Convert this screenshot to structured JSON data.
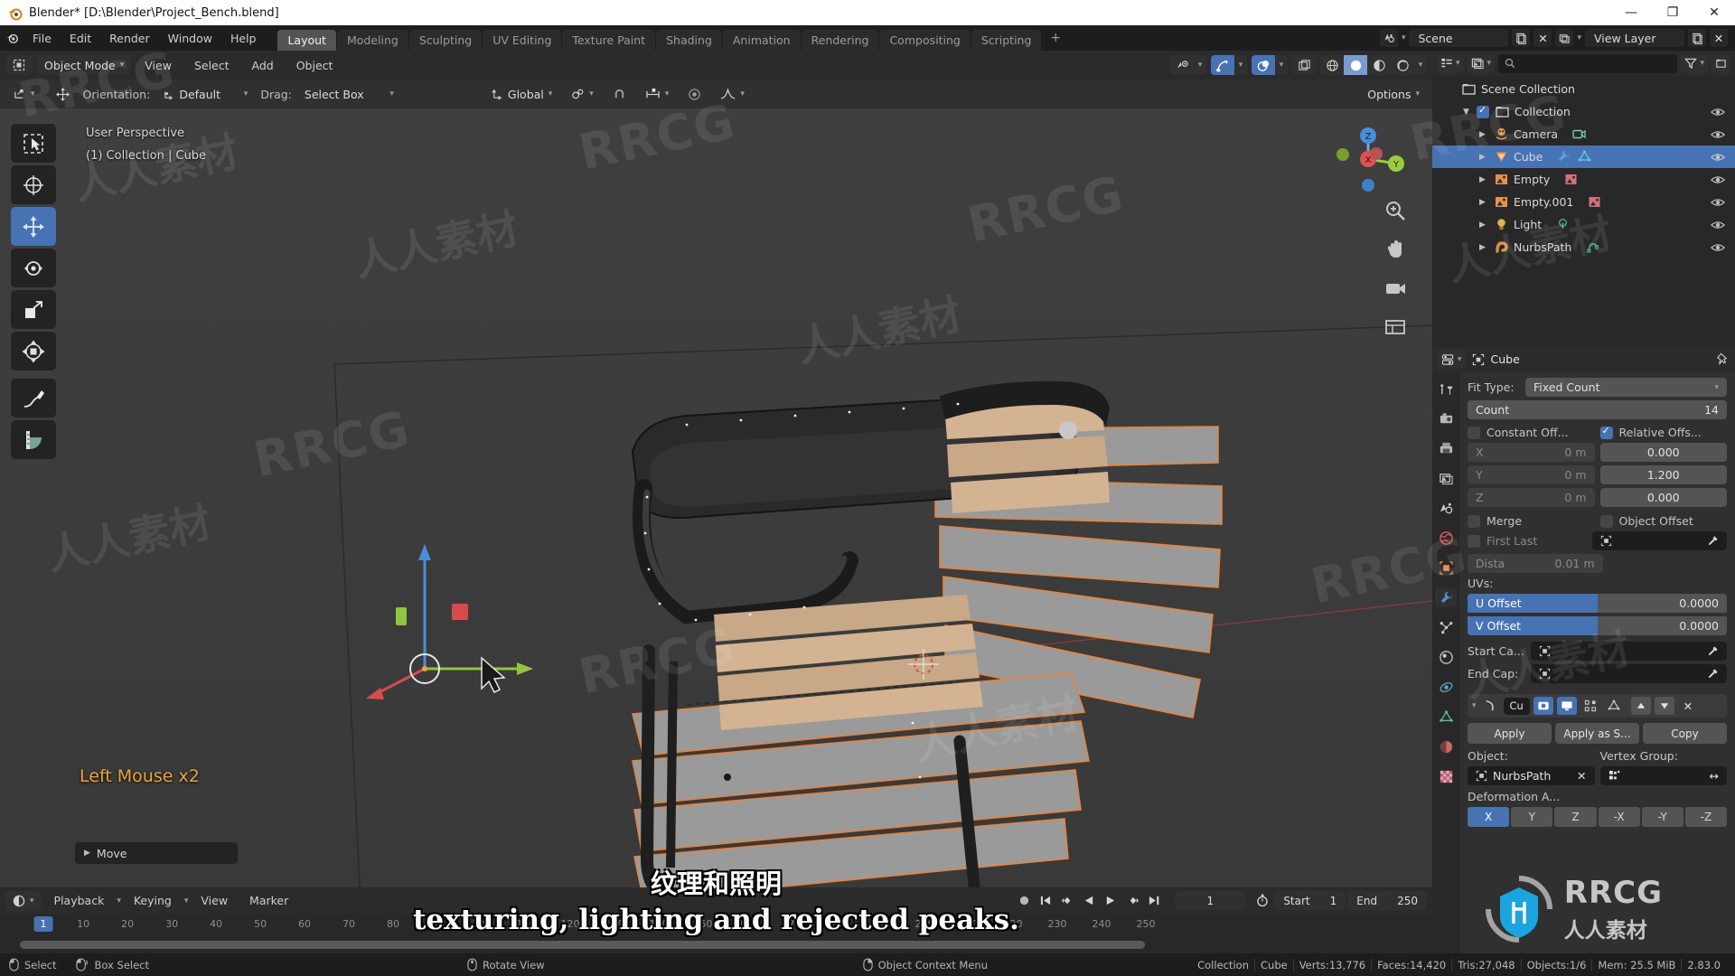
{
  "window": {
    "title": "Blender* [D:\\Blender\\Project_Bench.blend]",
    "minimize": "—",
    "maximize": "❐",
    "close": "✕"
  },
  "topbar": {
    "menus": [
      "File",
      "Edit",
      "Render",
      "Window",
      "Help"
    ],
    "workspaces": [
      {
        "label": "Layout",
        "active": true
      },
      {
        "label": "Modeling",
        "active": false
      },
      {
        "label": "Sculpting",
        "active": false
      },
      {
        "label": "UV Editing",
        "active": false
      },
      {
        "label": "Texture Paint",
        "active": false
      },
      {
        "label": "Shading",
        "active": false
      },
      {
        "label": "Animation",
        "active": false
      },
      {
        "label": "Rendering",
        "active": false
      },
      {
        "label": "Compositing",
        "active": false
      },
      {
        "label": "Scripting",
        "active": false
      }
    ],
    "add_workspace": "+",
    "scene_name": "Scene",
    "view_layer_name": "View Layer"
  },
  "tool_settings": {
    "orientation_label": "Orientation:",
    "orientation_value": "Default",
    "drag_label": "Drag:",
    "drag_value": "Select Box",
    "transform_orientation": "Global",
    "options_label": "Options"
  },
  "view3d_header": {
    "mode": "Object Mode",
    "menus": [
      "View",
      "Select",
      "Add",
      "Object"
    ]
  },
  "viewport": {
    "view_name": "User Perspective",
    "collection_line": "(1) Collection | Cube",
    "operator_panel": "Move",
    "status_message": "Left Mouse x2",
    "gizmo_axes": {
      "x": "X",
      "y": "Y",
      "z": "Z"
    },
    "tools": [
      "tweak-select-tool",
      "cursor-tool",
      "move-tool",
      "rotate-tool",
      "scale-tool",
      "transform-tool",
      "annotate-tool",
      "measure-tool"
    ]
  },
  "outliner": {
    "search_placeholder": "",
    "rows": [
      {
        "label": "Scene Collection",
        "icon": "collection-icon",
        "indent": 0,
        "selected": false,
        "checkbox": false,
        "disclosure": "",
        "extras": [],
        "eye": false
      },
      {
        "label": "Collection",
        "icon": "collection-icon",
        "indent": 1,
        "selected": false,
        "checkbox": true,
        "disclosure": "▼",
        "extras": [],
        "eye": true
      },
      {
        "label": "Camera",
        "icon": "camera-object-icon",
        "indent": 2,
        "selected": false,
        "checkbox": false,
        "disclosure": "▶",
        "extras": [
          "camera-data-icon"
        ],
        "eye": true
      },
      {
        "label": "Cube",
        "icon": "mesh-object-icon",
        "indent": 2,
        "selected": true,
        "checkbox": false,
        "disclosure": "▶",
        "extras": [
          "wrench-modifier-icon",
          "mesh-data-icon"
        ],
        "eye": true
      },
      {
        "label": "Empty",
        "icon": "empty-image-icon",
        "indent": 2,
        "selected": false,
        "checkbox": false,
        "disclosure": "▶",
        "extras": [
          "image-data-icon"
        ],
        "eye": true
      },
      {
        "label": "Empty.001",
        "icon": "empty-image-icon",
        "indent": 2,
        "selected": false,
        "checkbox": false,
        "disclosure": "▶",
        "extras": [
          "image-data-icon"
        ],
        "eye": true
      },
      {
        "label": "Light",
        "icon": "light-object-icon",
        "indent": 2,
        "selected": false,
        "checkbox": false,
        "disclosure": "▶",
        "extras": [
          "light-data-icon"
        ],
        "eye": true
      },
      {
        "label": "NurbsPath",
        "icon": "curve-object-icon",
        "indent": 2,
        "selected": false,
        "checkbox": false,
        "disclosure": "▶",
        "extras": [
          "curve-data-icon"
        ],
        "eye": true
      }
    ]
  },
  "properties": {
    "breadcrumb_object": "Cube",
    "array_modifier": {
      "fit_type_label": "Fit Type:",
      "fit_type_value": "Fixed Count",
      "count_label": "Count",
      "count_value": "14",
      "constant_offset_label": "Constant Off...",
      "relative_offset_label": "Relative Offs...",
      "constant_x_label": "X",
      "constant_x_value": "0 m",
      "constant_y_label": "Y",
      "constant_y_value": "0 m",
      "constant_z_label": "Z",
      "constant_z_value": "0 m",
      "relative_x_value": "0.000",
      "relative_y_value": "1.200",
      "relative_z_value": "0.000",
      "merge_label": "Merge",
      "object_offset_label": "Object Offset",
      "first_last_label": "First Last",
      "distance_label": "Dista",
      "distance_value": "0.01 m",
      "uvs_label": "UVs:",
      "u_offset_label": "U Offset",
      "u_offset_value": "0.0000",
      "v_offset_label": "V Offset",
      "v_offset_value": "0.0000",
      "start_cap_label": "Start Ca...",
      "end_cap_label": "End Cap:"
    },
    "curve_modifier": {
      "name": "Cu",
      "apply_label": "Apply",
      "apply_as_shape_label": "Apply as S...",
      "copy_label": "Copy",
      "object_label": "Object:",
      "object_value": "NurbsPath",
      "vertex_group_label": "Vertex Group:",
      "vertex_group_value": "",
      "deformation_axis_label": "Deformation A...",
      "axes": [
        {
          "label": "X",
          "on": true
        },
        {
          "label": "Y",
          "on": false
        },
        {
          "label": "Z",
          "on": false
        },
        {
          "label": "-X",
          "on": false
        },
        {
          "label": "-Y",
          "on": false
        },
        {
          "label": "-Z",
          "on": false
        }
      ]
    }
  },
  "timeline": {
    "menus": [
      "Playback",
      "Keying",
      "View",
      "Marker"
    ],
    "current_frame": "1",
    "start_label": "Start",
    "start_value": "1",
    "end_label": "End",
    "end_value": "250",
    "ticks": [
      10,
      20,
      30,
      40,
      50,
      60,
      70,
      80,
      90,
      100,
      110,
      120,
      130,
      140,
      150,
      160,
      170,
      180,
      190,
      200,
      210,
      220,
      230,
      240,
      250
    ],
    "playhead_label": "1"
  },
  "statusbar": {
    "hints": [
      {
        "icon": "mouse-left-icon",
        "label": "Select"
      },
      {
        "icon": "mouse-left-drag-icon",
        "label": "Box Select"
      },
      {
        "icon": "mouse-middle-icon",
        "label": "Rotate View"
      },
      {
        "icon": "mouse-right-icon",
        "label": "Object Context Menu"
      }
    ],
    "stats": [
      "Collection",
      "Cube",
      "Verts:13,776",
      "Faces:14,420",
      "Tris:27,048",
      "Objects:1/6",
      "Mem: 25.5 MiB",
      "2.83.0"
    ]
  },
  "subtitles": {
    "chinese": "纹理和照明",
    "english": "texturing, lighting and rejected peaks."
  },
  "watermarks": {
    "latin": "RRCG",
    "cjk": "人人素材",
    "badge_latin": "RRCG",
    "badge_cjk": "人人素材"
  },
  "colors": {
    "accent_blue": "#4772b3",
    "orange": "#e8a33d",
    "header_bg": "#2b2b2b",
    "panel_bg": "#303030",
    "viewport_bg": "#3f3f3f"
  }
}
